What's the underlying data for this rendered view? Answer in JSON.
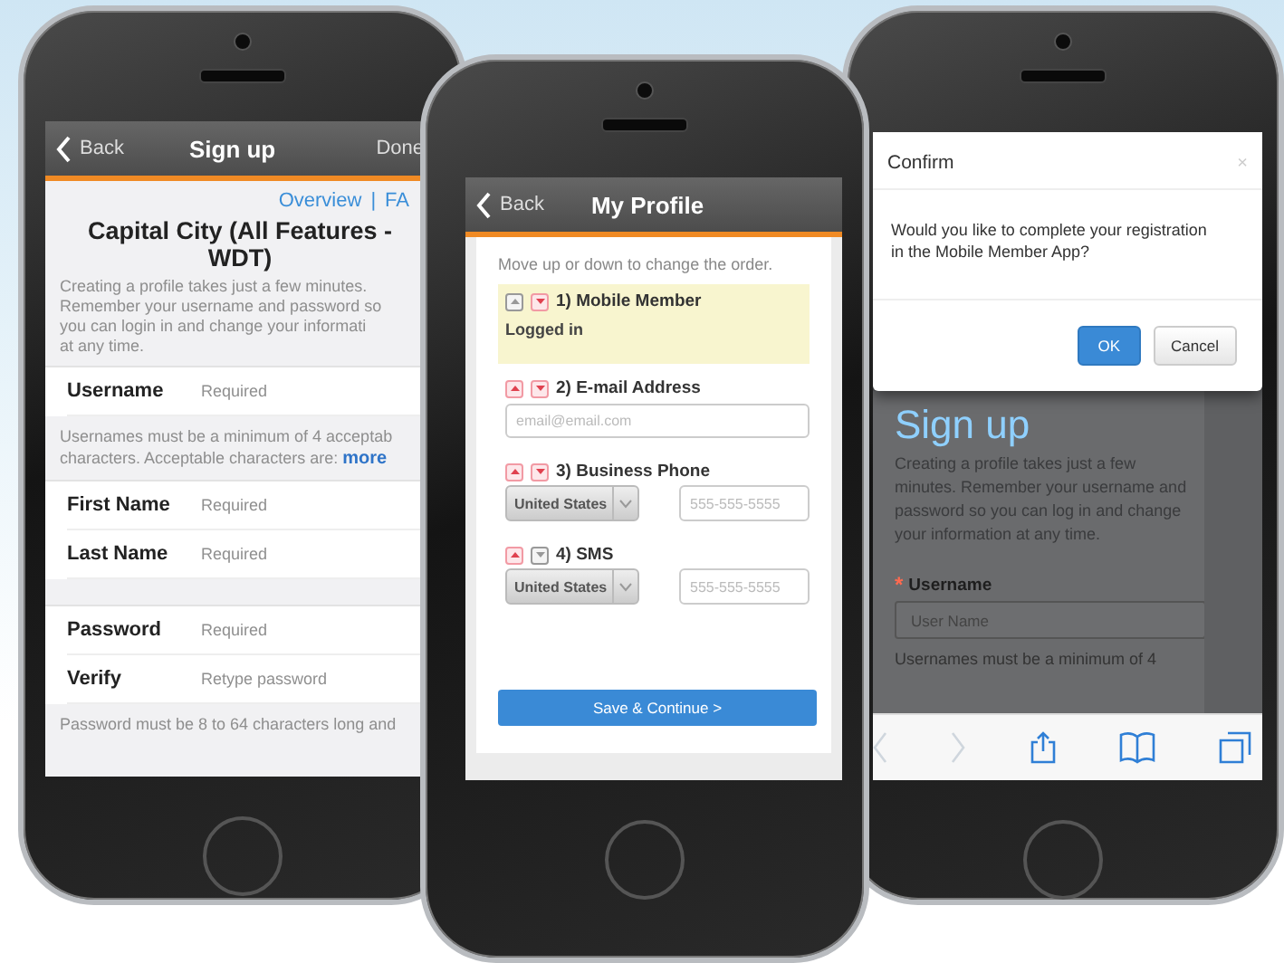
{
  "phones": [
    {
      "kind": "signup_form",
      "nav": {
        "back": "Back",
        "title": "Sign up",
        "done": "Done"
      },
      "links": [
        "Overview",
        "|",
        "FA"
      ],
      "heading": "Capital City (All Features - WDT)",
      "intro": [
        "Creating a profile takes just a few minutes.",
        "Remember your username and password so",
        "you can login in and change your informati",
        "at any time."
      ],
      "sections": [
        {
          "kind": "fields",
          "fields": [
            {
              "label": "Username",
              "placeholder": "Required"
            }
          ]
        },
        {
          "kind": "note",
          "lines": [
            "Usernames must be a minimum of 4 acceptab",
            "characters. Acceptable characters are:"
          ],
          "link": "more"
        },
        {
          "kind": "fields",
          "fields": [
            {
              "label": "First Name",
              "placeholder": "Required"
            },
            {
              "label": "Last Name",
              "placeholder": "Required"
            }
          ]
        },
        {
          "kind": "fields",
          "fields": [
            {
              "label": "Password",
              "placeholder": "Required"
            },
            {
              "label": "Verify",
              "placeholder": "Retype password"
            }
          ]
        },
        {
          "kind": "note",
          "lines": [
            "Password must be 8 to 64 characters long and"
          ]
        }
      ]
    },
    {
      "kind": "confirm_dialog",
      "dialog": {
        "title": "Confirm",
        "close": "×",
        "message": [
          "Would you like to complete your registration",
          "in the Mobile Member App?"
        ],
        "buttons": [
          {
            "label": "OK",
            "primary": true
          },
          {
            "label": "Cancel",
            "primary": false
          }
        ]
      },
      "page": {
        "heading": "Sign up",
        "intro": [
          "Creating a profile takes just a few",
          "minutes. Remember your username and",
          "password so you can log in and change",
          "your information at any time."
        ],
        "field": {
          "required_mark": "*",
          "label": "Username",
          "placeholder": "User Name"
        },
        "note": [
          "Usernames must be a minimum of 4"
        ]
      },
      "toolbar": {
        "back_enabled": false,
        "forward_enabled": false
      }
    },
    {
      "kind": "profile_order",
      "nav": {
        "back": "Back",
        "title": "My Profile"
      },
      "instruction": "Move up or down to change the order.",
      "contacts": [
        {
          "kind": "member",
          "title": "1) Mobile Member",
          "status": "Logged in",
          "highlighted": true,
          "up_enabled": false,
          "down_enabled": true
        },
        {
          "kind": "email",
          "title": "2) E-mail Address",
          "placeholder": "email@email.com",
          "highlighted": false,
          "up_enabled": true,
          "down_enabled": true
        },
        {
          "kind": "phone",
          "title": "3) Business Phone",
          "country": "United States",
          "placeholder": "555-555-5555",
          "highlighted": false,
          "up_enabled": true,
          "down_enabled": true
        },
        {
          "kind": "phone",
          "title": "4) SMS",
          "country": "United States",
          "placeholder": "555-555-5555",
          "highlighted": false,
          "up_enabled": true,
          "down_enabled": false
        }
      ],
      "save_button": "Save & Continue >"
    }
  ]
}
